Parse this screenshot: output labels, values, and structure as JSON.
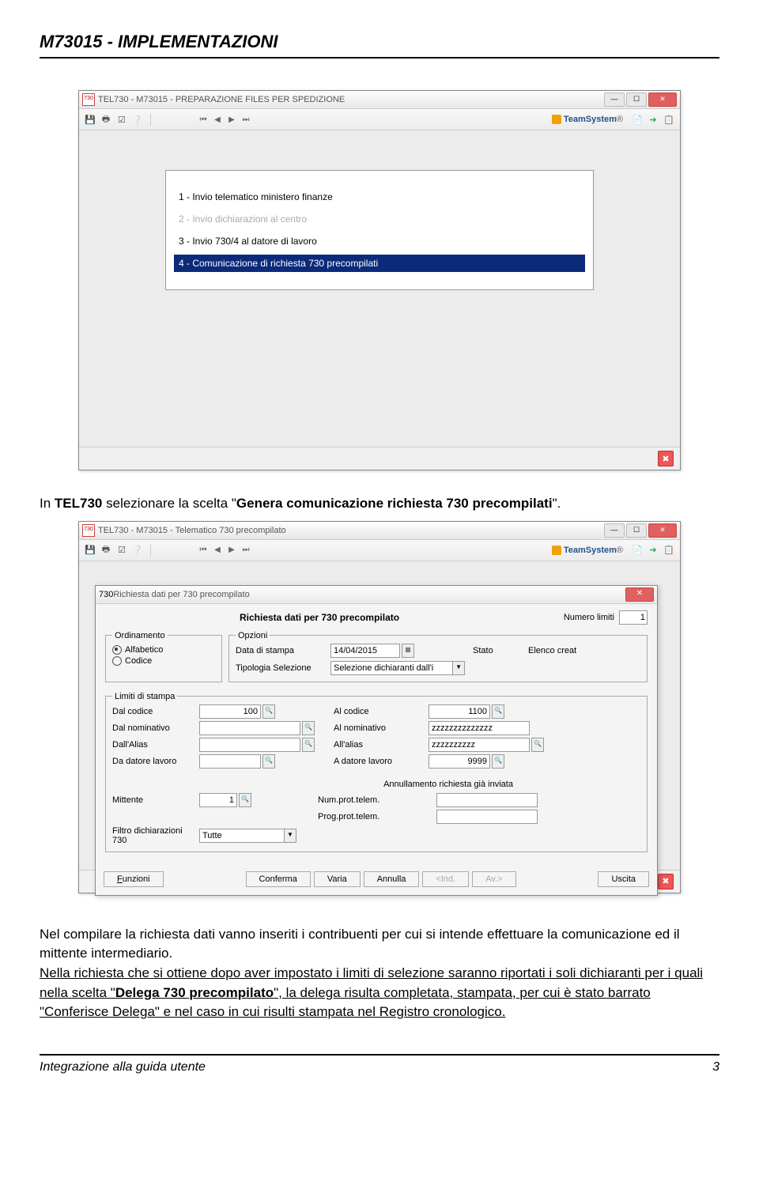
{
  "doc": {
    "title": "M73015 - IMPLEMENTAZIONI",
    "caption1_prefix": "In ",
    "caption1_bold1": "TEL730",
    "caption1_mid": " selezionare la scelta \"",
    "caption1_bold2": "Genera comunicazione richiesta 730 precompilati",
    "caption1_suffix": "\".",
    "para2": "Nel compilare la richiesta dati vanno inseriti i contribuenti per cui si intende effettuare la comunicazione ed il mittente intermediario.",
    "para3_a": "Nella richiesta che si ottiene dopo aver impostato i limiti di selezione saranno riportati i soli dichiaranti per i quali nella scelta \"",
    "para3_b": "Delega 730 precompilato",
    "para3_c": "\", la delega risulta completata, stampata, per cui è stato barrato \"",
    "para3_d": "Conferisce Delega",
    "para3_e": "\" e nel caso in cui risulti stampata nel Registro cronologico.",
    "footer_left": "Integrazione alla guida utente",
    "footer_right": "3"
  },
  "win1": {
    "icon": "730",
    "title": "TEL730  - M73015 -  PREPARAZIONE FILES PER SPEDIZIONE",
    "brand": "TeamSystem",
    "brand_suffix": "®",
    "menu": {
      "item1": "1 - Invio telematico ministero finanze",
      "item2": "2 - Invio dichiarazioni al centro",
      "item3": "3 - Invio 730/4 al datore di lavoro",
      "item4": "4 - Comunicazione di richiesta 730 precompilati"
    }
  },
  "win2": {
    "icon": "730",
    "title": "TEL730  - M73015 -  Telematico 730 precompilato",
    "brand": "TeamSystem",
    "brand_suffix": "®",
    "dialog": {
      "title": "Richiesta dati per 730 precompilato",
      "heading": "Richiesta dati per 730 precompilato",
      "numero_limiti_label": "Numero limiti",
      "numero_limiti_value": "1",
      "ordinamento_legend": "Ordinamento",
      "ord_alfabetico": "Alfabetico",
      "ord_codice": "Codice",
      "opzioni_legend": "Opzioni",
      "data_label": "Data di stampa",
      "data_value": "14/04/2015",
      "stato_label": "Stato",
      "elenco_label": "Elenco creat",
      "tipologia_label": "Tipologia Selezione",
      "tipologia_value": "Selezione dichiaranti dall'i",
      "limiti_legend": "Limiti di stampa",
      "dal_codice": "Dal codice",
      "dal_codice_v": "100",
      "al_codice": "Al codice",
      "al_codice_v": "1100",
      "dal_nom": "Dal nominativo",
      "al_nom": "Al nominativo",
      "al_nom_v": "zzzzzzzzzzzzzz",
      "dall_alias": "Dall'Alias",
      "all_alias": "All'alias",
      "all_alias_v": "zzzzzzzzzz",
      "da_datore": "Da  datore lavoro",
      "a_datore": "A datore lavoro",
      "a_datore_v": "9999",
      "annullamento": "Annullamento richiesta già inviata",
      "mittente_label": "Mittente",
      "mittente_v": "1",
      "num_prot": "Num.prot.telem.",
      "prog_prot": "Prog.prot.telem.",
      "filtro_label": "Filtro dichiarazioni 730",
      "filtro_v": "Tutte",
      "btn_funzioni": "Funzioni",
      "btn_conferma": "Conferma",
      "btn_varia": "Varia",
      "btn_annulla": "Annulla",
      "btn_ind": "<Ind.",
      "btn_av": "Av.>",
      "btn_uscita": "Uscita"
    }
  }
}
